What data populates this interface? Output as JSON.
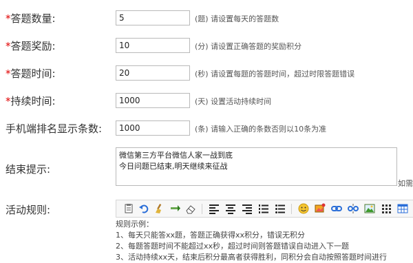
{
  "form": {
    "fields": [
      {
        "required": "*",
        "label": "答题数量:",
        "value": "5",
        "hint": "(题) 请设置每天的答题数"
      },
      {
        "required": "*",
        "label": "答题奖励:",
        "value": "10",
        "hint": "(分) 请设置正确答题的奖励积分"
      },
      {
        "required": "*",
        "label": "答题时间:",
        "value": "20",
        "hint": "(秒) 请设置每题的答题时间，超过时限答题错误"
      },
      {
        "required": "*",
        "label": "持续时间:",
        "value": "1000",
        "hint": "(天) 设置活动持续时间"
      },
      {
        "required": "",
        "label": "手机端排名显示条数:",
        "value": "1000",
        "hint": "(条) 请输入正确的条数否则以10条为准"
      }
    ],
    "end_tip": {
      "label": "结束提示:",
      "lines": [
        "微信第三方平台微信人家一战到底",
        "今日问题已结束,明天继续来征战"
      ],
      "side_hint": "如需"
    },
    "rules": {
      "label": "活动规则:",
      "toolbar_icons": [
        "paste-icon",
        "undo-icon",
        "clear-format-icon",
        "insert-row-icon",
        "eraser-icon",
        "align-left-icon",
        "align-center-icon",
        "align-right-icon",
        "ordered-list-icon",
        "unordered-list-icon",
        "emoticon-icon",
        "image-icon",
        "link-icon",
        "unlink-icon",
        "picture-icon",
        "table-grid-icon",
        "table-icon"
      ],
      "content": [
        "规则示例：",
        "1、每天只能答xx题，答题正确获得xx积分，错误无积分",
        "2、每题答题时间不能超过xx秒，超过时间则答题错误自动进入下一题",
        "3、活动持续xx天，结束后积分最高者获得胜利，同积分会自动按照答题时间进行"
      ]
    }
  }
}
